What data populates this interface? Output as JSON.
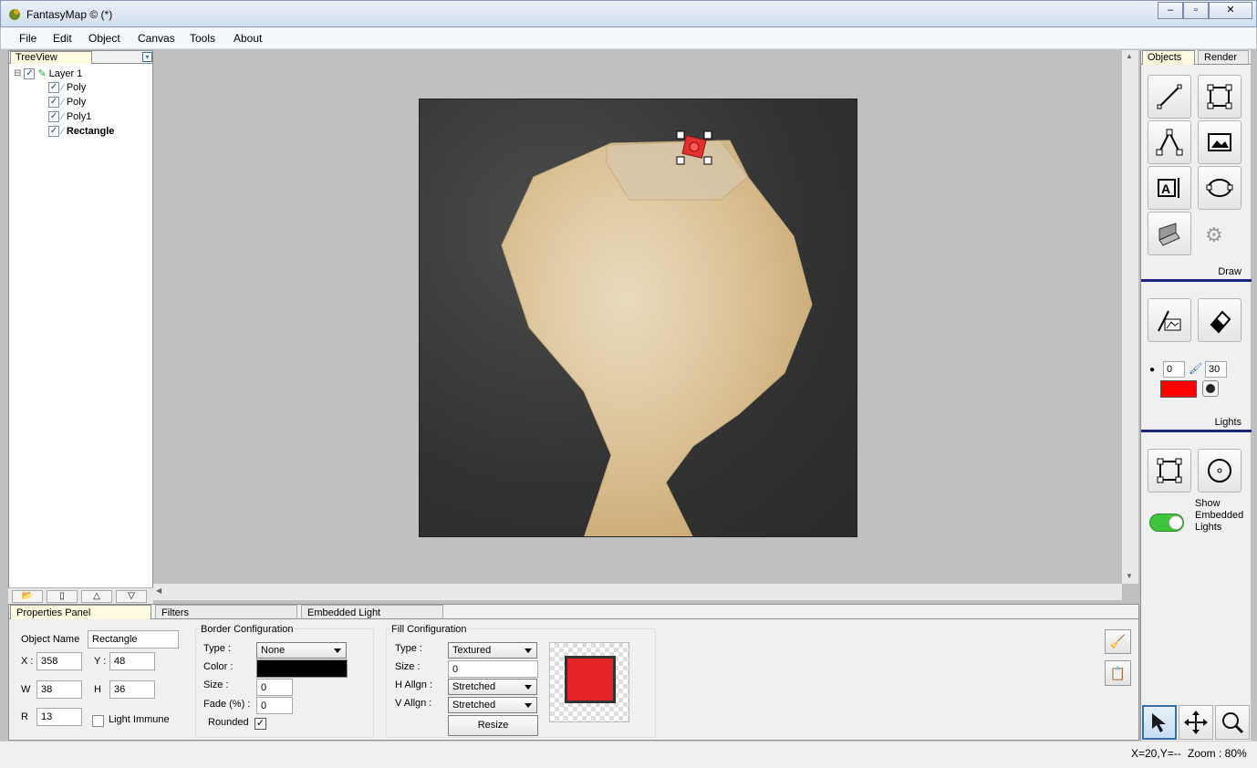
{
  "window": {
    "title": "FantasyMap © (*)",
    "minimize": "‒",
    "restore": "▫",
    "close": "✕"
  },
  "menu": {
    "items": [
      "File",
      "Edit",
      "Object",
      "Canvas",
      "Tools",
      "About"
    ]
  },
  "treeview": {
    "tab": "TreeView",
    "root": {
      "label": "Layer 1",
      "expander": "⊟"
    },
    "children": [
      {
        "label": "Poly",
        "bold": false
      },
      {
        "label": "Poly",
        "bold": false
      },
      {
        "label": "Poly1",
        "bold": false
      },
      {
        "label": "Rectangle",
        "bold": true
      }
    ],
    "check": "✓"
  },
  "right_panel": {
    "tabs": [
      "Objects",
      "Render"
    ],
    "draw_label": "Draw",
    "lights_label": "Lights",
    "brush_size": "0",
    "brush_width": "30",
    "brush_color": "#ff0000",
    "show_embedded_lights": "Show Embedded Lights",
    "toggle_on": true
  },
  "bottom_tabs": [
    "Properties Panel",
    "Filters",
    "Embedded Light"
  ],
  "properties": {
    "object_name_label": "Object Name",
    "object_name": "Rectangle",
    "x_label": "X :",
    "x": "358",
    "y_label": "Y :",
    "y": "48",
    "w_label": "W",
    "w": "38",
    "h_label": "H",
    "h": "36",
    "r_label": "R",
    "r": "13",
    "light_immune": "Light Immune"
  },
  "border_config": {
    "title": "Border Configuration",
    "type_label": "Type :",
    "type": "None",
    "color_label": "Color :",
    "color": "#000000",
    "size_label": "Size :",
    "size": "0",
    "fade_label": "Fade (%) :",
    "fade": "0",
    "rounded_label": "Rounded",
    "rounded_check": "✓"
  },
  "fill_config": {
    "title": "Fill Configuration",
    "type_label": "Type :",
    "type": "Textured",
    "size_label": "Size :",
    "size": "0",
    "halign_label": "H Allgn :",
    "halign": "Stretched",
    "valign_label": "V Allgn :",
    "valign": "Stretched",
    "resize_button": "Resize"
  },
  "status": {
    "coords": "X=20,Y=--",
    "zoom": "Zoom : 80%"
  }
}
